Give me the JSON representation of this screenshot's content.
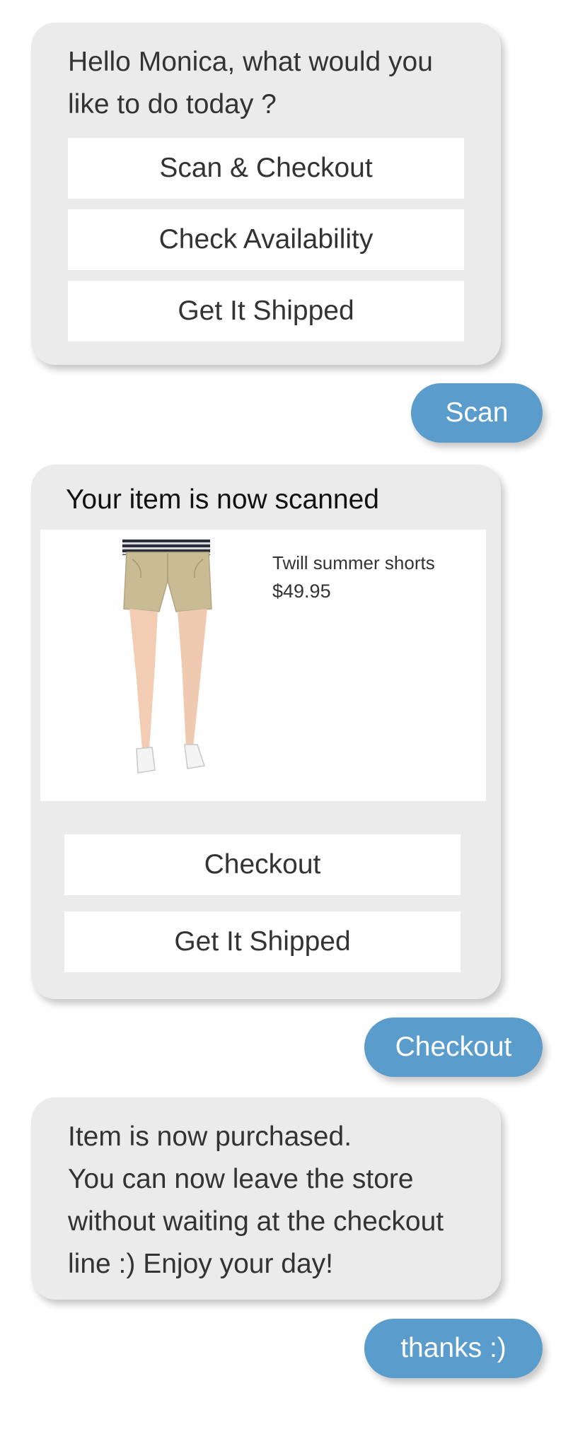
{
  "greeting_message": {
    "text": "Hello Monica, what would you like to do today ?",
    "options": [
      "Scan & Checkout",
      "Check Availability",
      "Get It Shipped"
    ]
  },
  "user_reply_1": "Scan",
  "scanned_message": {
    "title": "Your item is now scanned",
    "product": {
      "name": "Twill summer shorts",
      "price": "$49.95",
      "image": "product-photo-shorts"
    },
    "options": [
      "Checkout",
      "Get It Shipped"
    ]
  },
  "user_reply_2": "Checkout",
  "purchased_message": {
    "lines": [
      "Item is now purchased.",
      "You can now leave the store",
      "without waiting at the checkout",
      "line :) Enjoy your day!"
    ]
  },
  "user_reply_3": "thanks :)",
  "colors": {
    "bot_bubble": "#ebebeb",
    "user_bubble": "#5a9ccb",
    "option_button": "#ffffff"
  }
}
